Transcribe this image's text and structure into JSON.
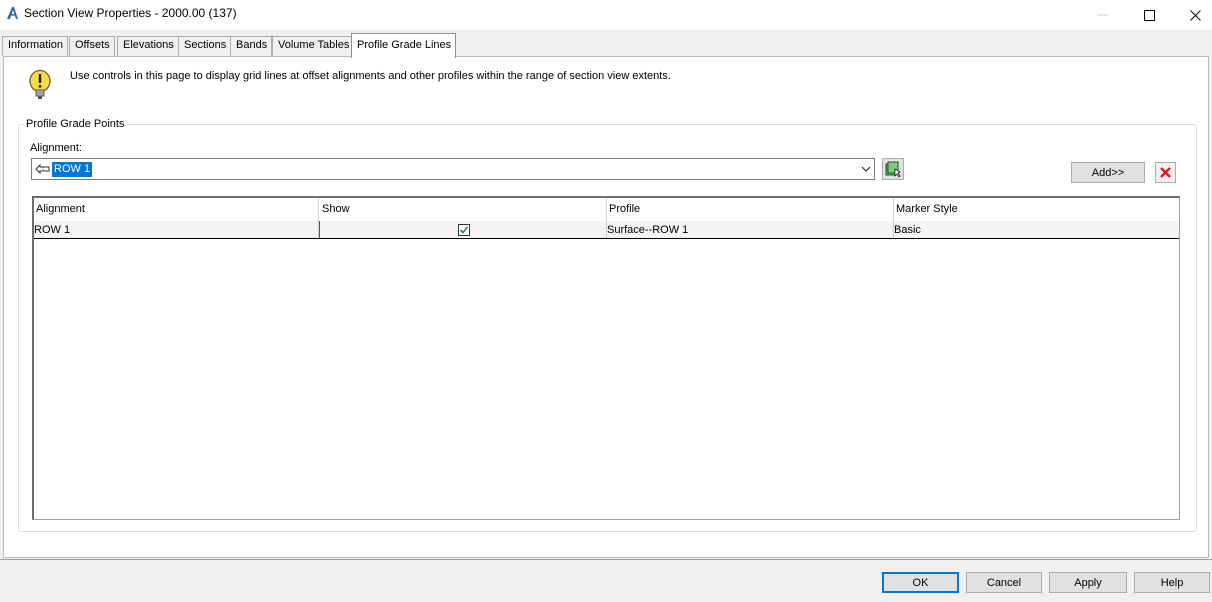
{
  "window": {
    "title": "Section View Properties - 2000.00 (137)",
    "app_icon": "autocad-civil-icon"
  },
  "tabs": [
    {
      "label": "Information"
    },
    {
      "label": "Offsets"
    },
    {
      "label": "Elevations"
    },
    {
      "label": "Sections"
    },
    {
      "label": "Bands"
    },
    {
      "label": "Volume Tables"
    },
    {
      "label": "Profile Grade Lines",
      "active": true
    }
  ],
  "info": {
    "icon": "exclamation-bulb-icon",
    "text": "Use controls in this page to display grid lines at offset alignments and other profiles within the range of section view extents."
  },
  "group": {
    "title": "Profile Grade Points",
    "alignment_label": "Alignment:",
    "alignment_value": "ROW 1",
    "add_label": "Add>>"
  },
  "table": {
    "columns": [
      "Alignment",
      "Show",
      "Profile",
      "Marker Style"
    ],
    "rows": [
      {
        "alignment": "ROW 1",
        "show": true,
        "profile": "Surface--ROW 1",
        "marker_style": "Basic"
      }
    ]
  },
  "footer": {
    "ok": "OK",
    "cancel": "Cancel",
    "apply": "Apply",
    "help": "Help"
  },
  "colors": {
    "selection": "#0078d7",
    "delete_red": "#e81123",
    "check_green": "#1e8a3a"
  }
}
